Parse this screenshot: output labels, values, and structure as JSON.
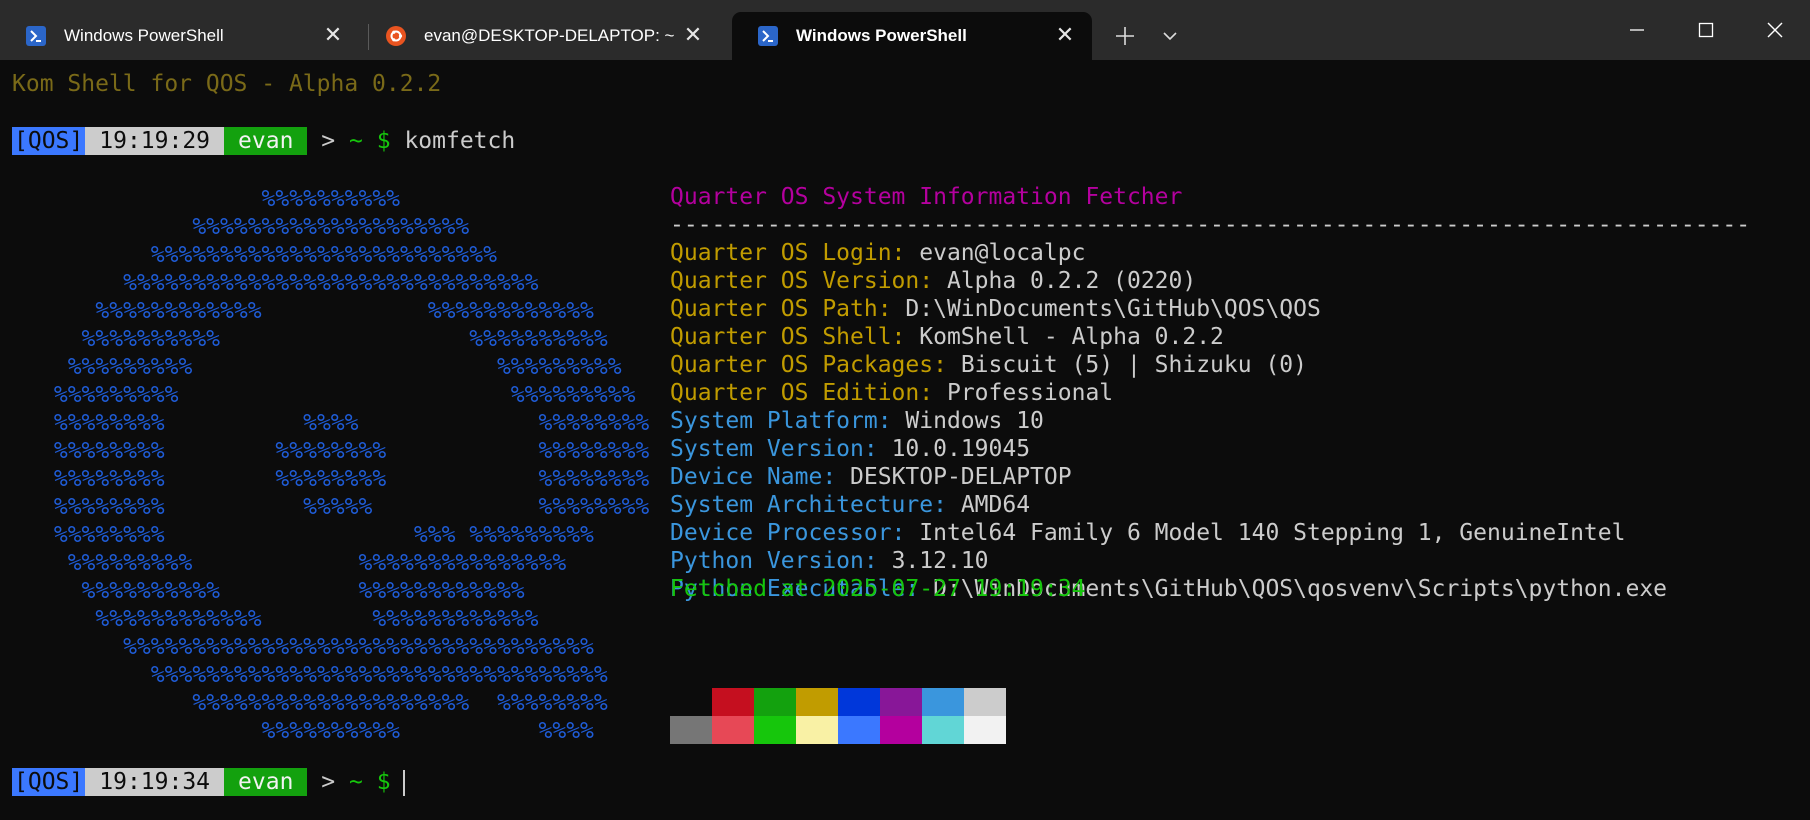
{
  "tabs": [
    {
      "title": "Windows PowerShell",
      "icon": "powershell-icon",
      "active": false
    },
    {
      "title": "evan@DESKTOP-DELAPTOP: ~",
      "icon": "ubuntu-icon",
      "active": false
    },
    {
      "title": "Windows PowerShell",
      "icon": "powershell-icon",
      "active": true
    }
  ],
  "titlebar": {
    "new_tab_icon": "plus-icon",
    "dropdown_icon": "chevron-down-icon",
    "minimize_icon": "minimize-icon",
    "maximize_icon": "maximize-icon",
    "close_icon": "close-icon"
  },
  "terminal": {
    "banner": "Kom Shell for QOS - Alpha 0.2.2",
    "prompt1": {
      "tag": "[QOS]",
      "time": "19:19:29",
      "user": "evan",
      "arrow": ">",
      "path": "~",
      "dollar": "$",
      "command": "komfetch"
    },
    "prompt2": {
      "tag": "[QOS]",
      "time": "19:19:34",
      "user": "evan",
      "arrow": ">",
      "path": "~",
      "dollar": "$",
      "command": ""
    },
    "ascii_art": [
      "                %%%%%%%%%%",
      "           %%%%%%%%%%%%%%%%%%%%",
      "        %%%%%%%%%%%%%%%%%%%%%%%%%",
      "      %%%%%%%%%%%%%%%%%%%%%%%%%%%%%%",
      "    %%%%%%%%%%%%            %%%%%%%%%%%%",
      "   %%%%%%%%%%                  %%%%%%%%%%",
      "  %%%%%%%%%                      %%%%%%%%%",
      " %%%%%%%%%                        %%%%%%%%%",
      " %%%%%%%%          %%%%             %%%%%%%%",
      " %%%%%%%%        %%%%%%%%           %%%%%%%%",
      " %%%%%%%%        %%%%%%%%           %%%%%%%%",
      " %%%%%%%%          %%%%%            %%%%%%%%",
      " %%%%%%%%                  %%% %%%%%%%%%",
      "  %%%%%%%%%            %%%%%%%%%%%%%%%",
      "   %%%%%%%%%%          %%%%%%%%%%%%",
      "    %%%%%%%%%%%%        %%%%%%%%%%%%",
      "      %%%%%%%%%%%%%%%%%%%%%%%%%%%%%%%%%%",
      "        %%%%%%%%%%%%%%%%%%%%%%%%%%%%%%%%%",
      "           %%%%%%%%%%%%%%%%%%%%  %%%%%%%%",
      "                %%%%%%%%%%          %%%%"
    ],
    "info": {
      "header": "Quarter OS System Information Fetcher",
      "rule": "------------------------------------------------------------------------------",
      "qos_fields": [
        {
          "key": "Quarter OS Login:",
          "value": "evan@localpc"
        },
        {
          "key": "Quarter OS Version:",
          "value": "Alpha 0.2.2 (0220)"
        },
        {
          "key": "Quarter OS Path:",
          "value": "D:\\WinDocuments\\GitHub\\QOS\\QOS"
        },
        {
          "key": "Quarter OS Shell:",
          "value": "KomShell - Alpha 0.2.2"
        },
        {
          "key": "Quarter OS Packages:",
          "value": "Biscuit (5) | Shizuku (0)"
        },
        {
          "key": "Quarter OS Edition:",
          "value": "Professional"
        }
      ],
      "system_fields": [
        {
          "key": "System Platform:",
          "value": "Windows 10"
        },
        {
          "key": "System Version:",
          "value": "10.0.19045"
        },
        {
          "key": "Device Name:",
          "value": "DESKTOP-DELAPTOP"
        },
        {
          "key": "System Architecture:",
          "value": "AMD64"
        },
        {
          "key": "Device Processor:",
          "value": "Intel64 Family 6 Model 140 Stepping 1, GenuineIntel"
        },
        {
          "key": "Python Version:",
          "value": "3.12.10"
        },
        {
          "key": "Python Executable:",
          "value": "D:\\WinDocuments\\GitHub\\QOS\\qosvenv\\Scripts\\python.exe"
        }
      ],
      "fetched": "Fetched at 2025-07-27 19:19:34"
    },
    "palette": {
      "normal": [
        "#0c0c0c",
        "#c50f1f",
        "#13a10e",
        "#c19c00",
        "#0037da",
        "#881798",
        "#3a96dd",
        "#cccccc"
      ],
      "bright": [
        "#767676",
        "#e74856",
        "#16c60c",
        "#f9f1a5",
        "#3b78ff",
        "#b4009e",
        "#61d6d6",
        "#f2f2f2"
      ]
    }
  }
}
